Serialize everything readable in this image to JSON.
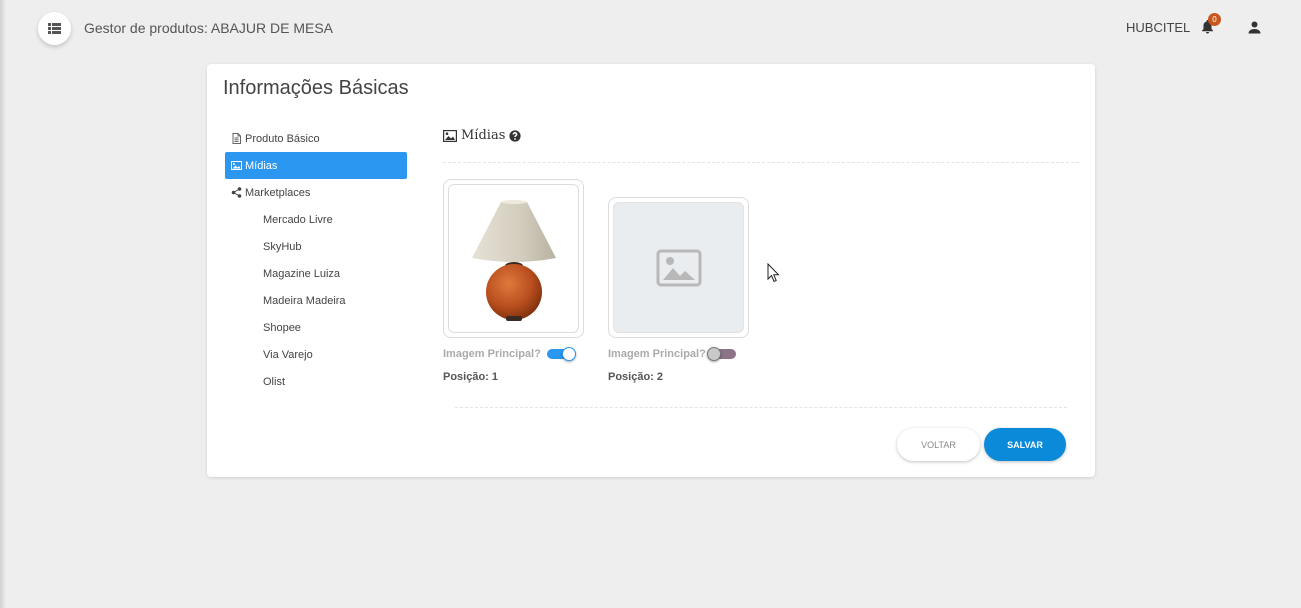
{
  "header": {
    "title": "Gestor de produtos: ABAJUR DE MESA",
    "user_name": "HUBCITEL",
    "notifications_count": "0"
  },
  "card": {
    "title": "Informações Básicas"
  },
  "nav": {
    "items": [
      {
        "label": "Produto Básico",
        "icon": "file-icon"
      },
      {
        "label": "Mídias",
        "icon": "image-icon",
        "active": true
      },
      {
        "label": "Marketplaces",
        "icon": "share-icon"
      }
    ],
    "marketplaces": [
      "Mercado Livre",
      "SkyHub",
      "Magazine Luiza",
      "Madeira Madeira",
      "Shopee",
      "Via Varejo",
      "Olist"
    ]
  },
  "section": {
    "title": "Mídias"
  },
  "media": [
    {
      "main_label": "Imagem Principal?",
      "main": true,
      "position_label": "Posição: 1",
      "image": "table-lamp"
    },
    {
      "main_label": "Imagem Principal?",
      "main": false,
      "position_label": "Posição: 2",
      "image": "placeholder"
    }
  ],
  "buttons": {
    "back": "VOLTAR",
    "save": "SALVAR"
  },
  "colors": {
    "accent": "#2b97f0",
    "save_button": "#0a8ad9",
    "badge": "#c6571e",
    "background": "#eeeeee"
  }
}
